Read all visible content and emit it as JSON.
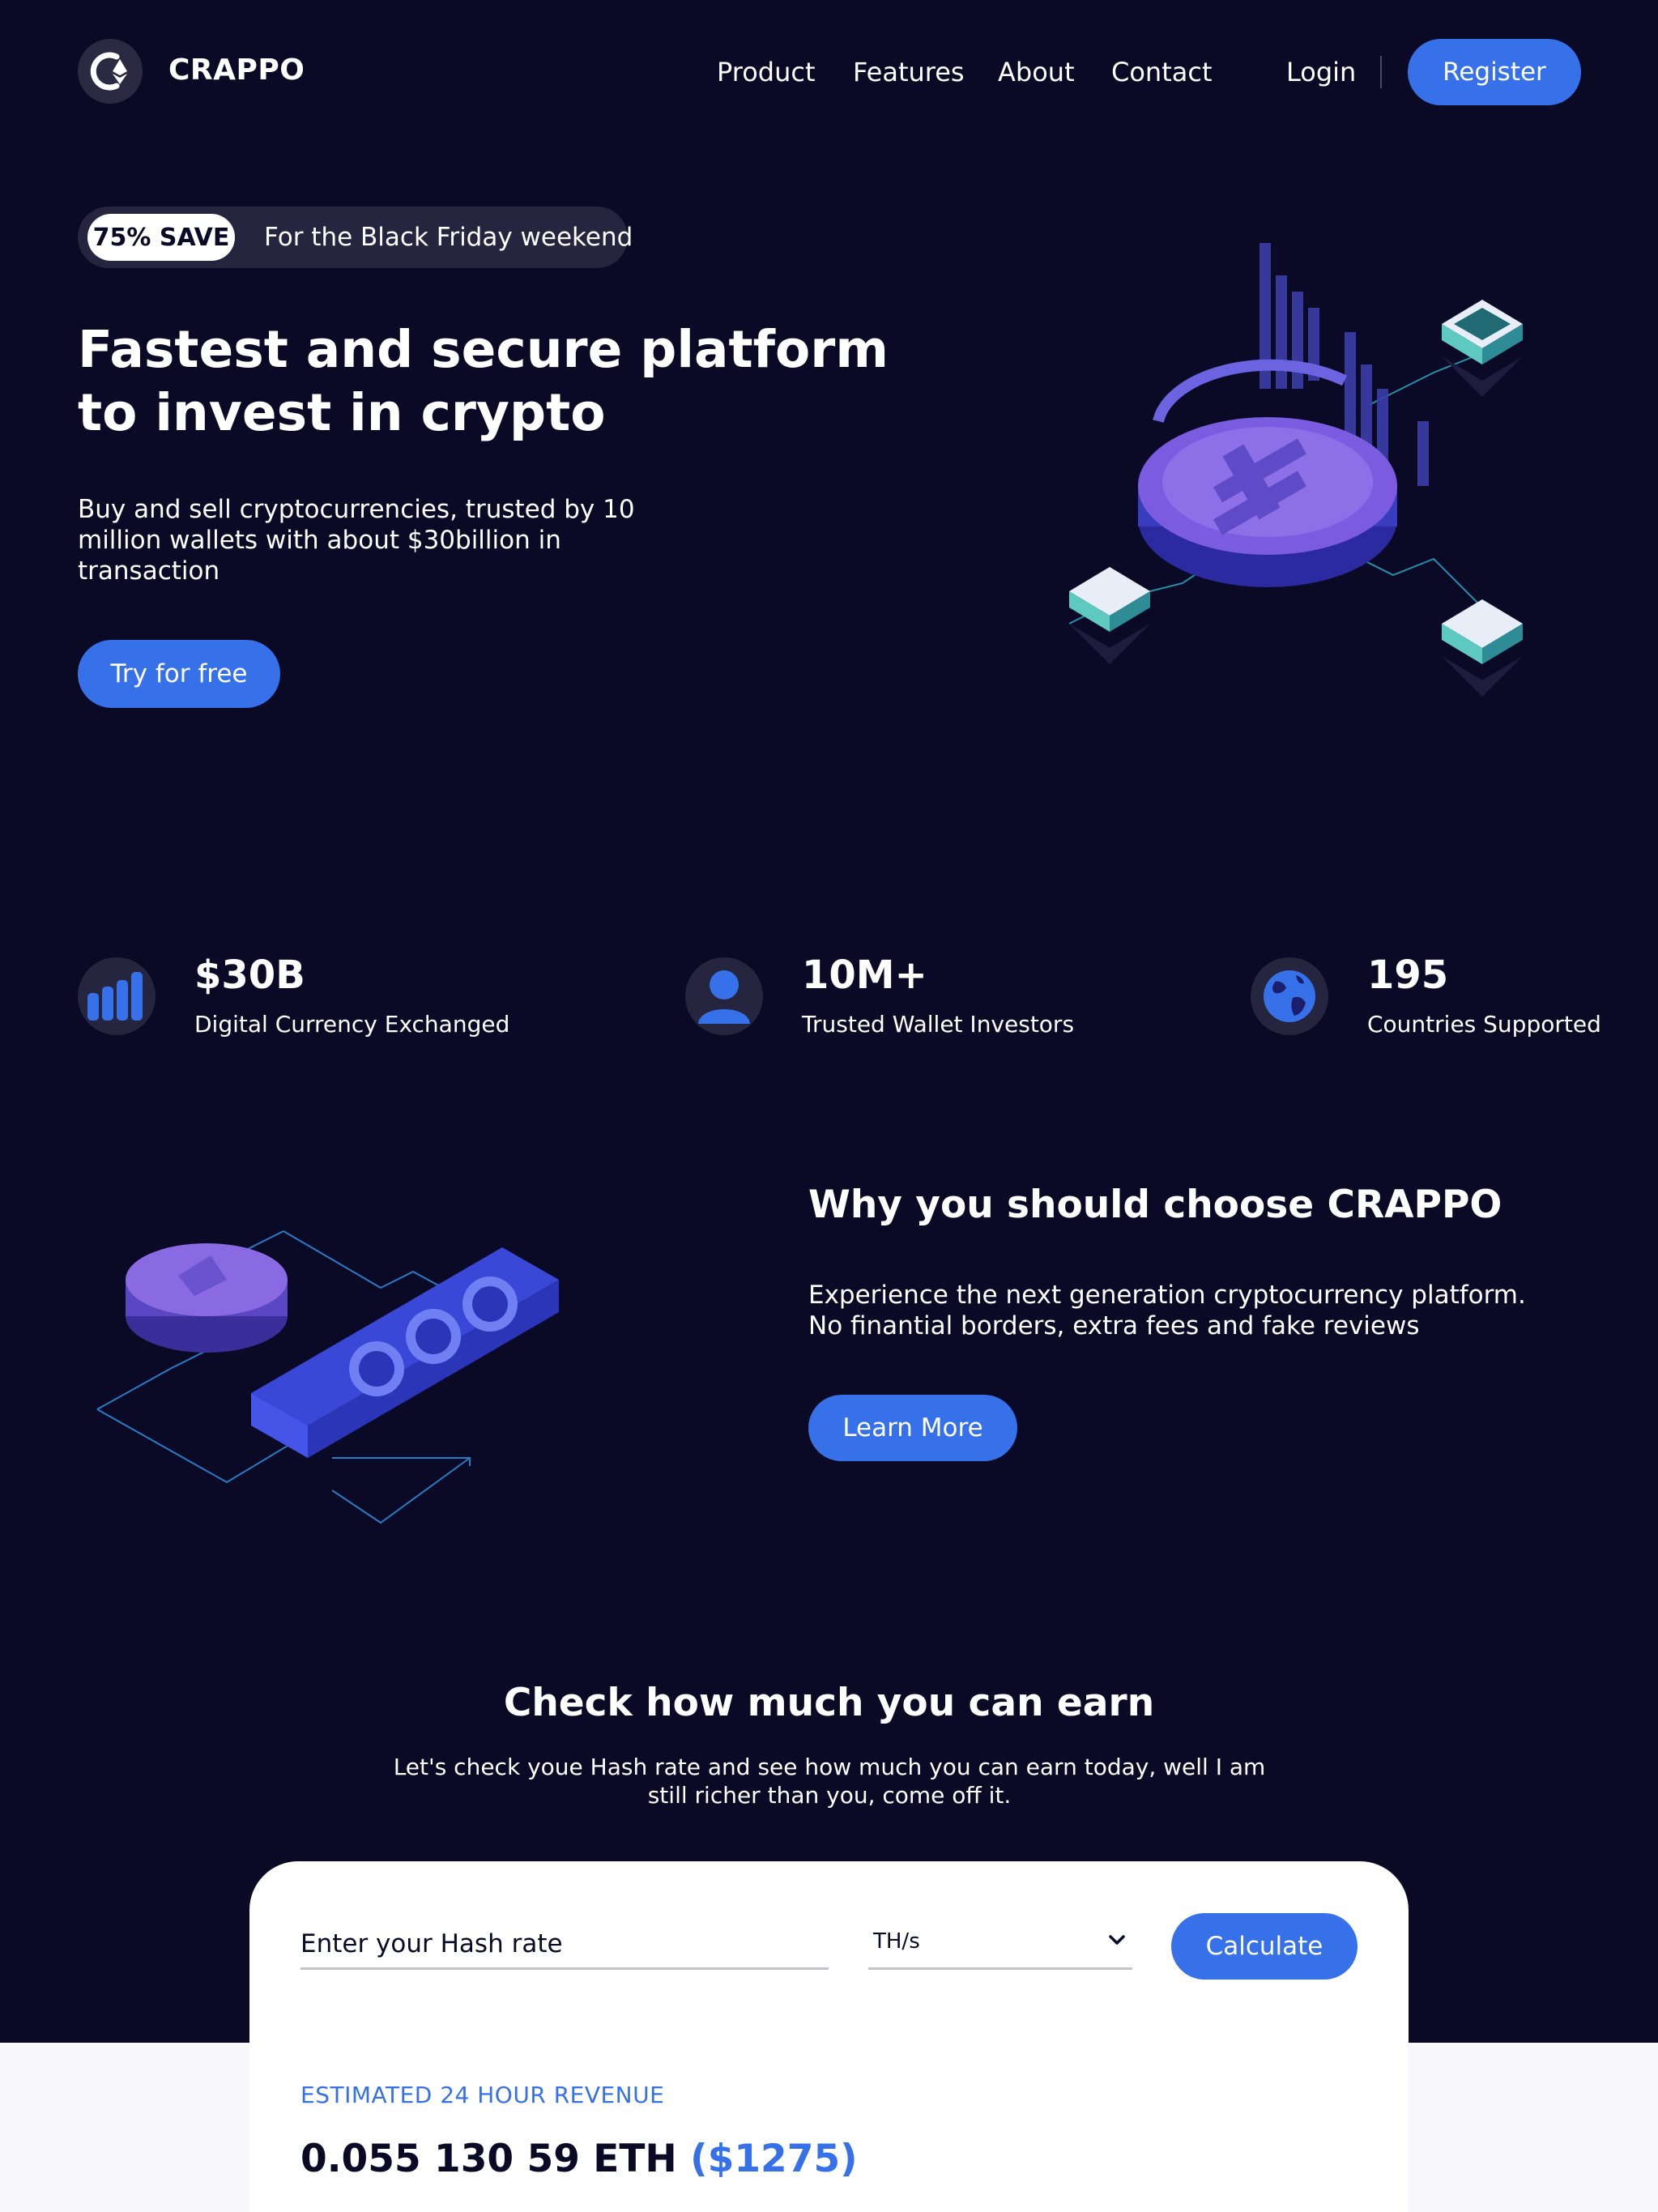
{
  "brand": {
    "name": "CRAPPO"
  },
  "nav": {
    "items": [
      {
        "label": "Product"
      },
      {
        "label": "Features"
      },
      {
        "label": "About"
      },
      {
        "label": "Contact"
      }
    ],
    "login": "Login",
    "register": "Register"
  },
  "hero": {
    "badge": "75% SAVE",
    "promo": "For the Black Friday weekend",
    "title": "Fastest and secure platform to invest in crypto",
    "subtitle": "Buy and sell cryptocurrencies, trusted by 10 million wallets with about $30billion in transaction",
    "cta": "Try for free"
  },
  "stats": [
    {
      "value": "$30B",
      "label": "Digital Currency Exchanged",
      "icon": "bar-chart-icon"
    },
    {
      "value": "10M+",
      "label": "Trusted Wallet Investors",
      "icon": "user-icon"
    },
    {
      "value": "195",
      "label": "Countries Supported",
      "icon": "globe-icon"
    }
  ],
  "why": {
    "title": "Why you should choose CRAPPO",
    "text": "Experience the next generation cryptocurrency platform. No finantial borders, extra fees and fake reviews",
    "cta": "Learn More"
  },
  "earn": {
    "title": "Check how much you can earn",
    "subtitle": "Let's check youe Hash rate and see how much you can earn today, well I am still richer than you, come off it.",
    "input_placeholder": "Enter your Hash rate",
    "unit": "TH/s",
    "calculate": "Calculate",
    "revenue_label": "ESTIMATED 24 HOUR REVENUE",
    "revenue_eth": "0.055 130 59 ETH",
    "revenue_usd": "($1275)"
  },
  "colors": {
    "background": "#0b0a26",
    "accent": "#3671e9",
    "surface": "#26253f",
    "purple": "#7b5ce0"
  }
}
